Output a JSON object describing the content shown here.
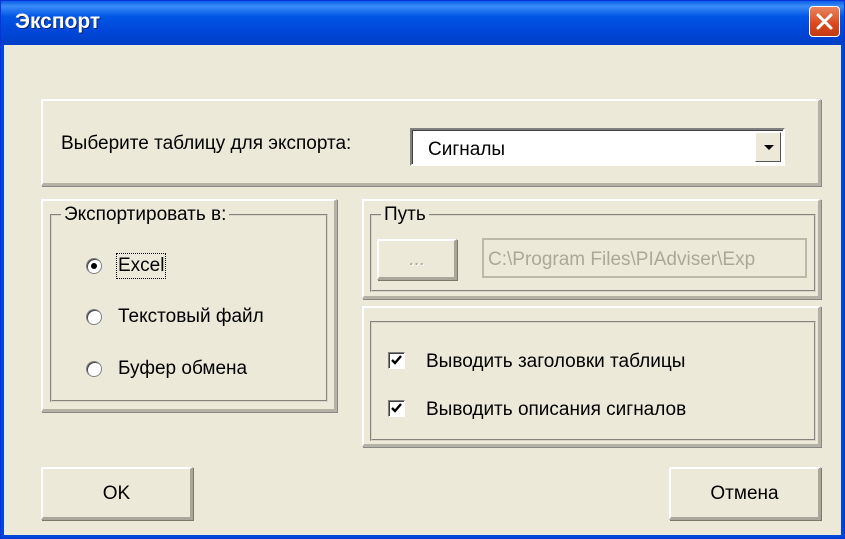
{
  "window": {
    "title": "Экспорт"
  },
  "table_select": {
    "label": "Выберите таблицу для экспорта:",
    "selected": "Сигналы"
  },
  "export_to": {
    "legend": "Экспортировать в:",
    "options": [
      {
        "label": "Excel",
        "checked": true
      },
      {
        "label": "Текстовый файл",
        "checked": false
      },
      {
        "label": "Буфер обмена",
        "checked": false
      }
    ]
  },
  "path": {
    "legend": "Путь",
    "browse_label": "...",
    "value": "C:\\Program Files\\PIAdviser\\Exp"
  },
  "options": {
    "items": [
      {
        "label": "Выводить заголовки таблицы",
        "checked": true
      },
      {
        "label": "Выводить описания сигналов",
        "checked": true
      }
    ]
  },
  "buttons": {
    "ok": "OK",
    "cancel": "Отмена"
  }
}
